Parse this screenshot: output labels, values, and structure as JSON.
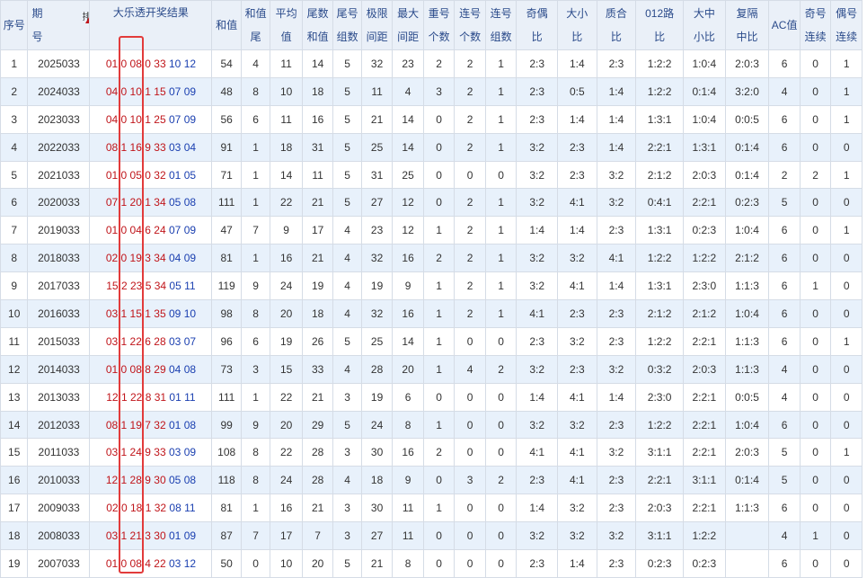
{
  "headers": {
    "idx": "序号",
    "period1": "期",
    "period2": "号",
    "sort": "排序",
    "result": "大乐透开奖结果",
    "sum": "和值",
    "sumtail1": "和值",
    "sumtail2": "尾",
    "avg1": "平均",
    "avg2": "值",
    "tailsum1": "尾数",
    "tailsum2": "和值",
    "tailgroup1": "尾号",
    "tailgroup2": "组数",
    "span1": "极限",
    "span2": "间距",
    "maxgap1": "最大",
    "maxgap2": "间距",
    "repeat1": "重号",
    "repeat2": "个数",
    "consec1": "连号",
    "consec2": "个数",
    "consecg1": "连号",
    "consecg2": "组数",
    "oddeven1": "奇偶",
    "oddeven2": "比",
    "bigsmall1": "大小",
    "bigsmall2": "比",
    "prime1": "质合",
    "prime2": "比",
    "road1": "012路",
    "road2": "比",
    "bms1": "大中",
    "bms2": "小比",
    "rep1": "复隔",
    "rep2": "中比",
    "ac": "AC值",
    "oddc1": "奇号",
    "oddc2": "连续",
    "evenc1": "偶号",
    "evenc2": "连续"
  },
  "rows": [
    {
      "i": "1",
      "p": "2025033",
      "r": [
        "01",
        "0",
        "08",
        "0",
        "33"
      ],
      "b": [
        "10",
        "12"
      ],
      "s": "54",
      "st": "4",
      "a": "11",
      "ts": "14",
      "tg": "5",
      "sp": "32",
      "mg": "23",
      "rp": "2",
      "cn": "2",
      "cg": "1",
      "oe": "2:3",
      "bs": "1:4",
      "pc": "2:3",
      "rd": "1:2:2",
      "bm": "1:0:4",
      "rh": "2:0:3",
      "ac": "6",
      "oc": "0",
      "ec": "1"
    },
    {
      "i": "2",
      "p": "2024033",
      "r": [
        "04",
        "0",
        "10",
        "1",
        "15"
      ],
      "b": [
        "07",
        "09"
      ],
      "s": "48",
      "st": "8",
      "a": "10",
      "ts": "18",
      "tg": "5",
      "sp": "11",
      "mg": "4",
      "rp": "3",
      "cn": "2",
      "cg": "1",
      "oe": "2:3",
      "bs": "0:5",
      "pc": "1:4",
      "rd": "1:2:2",
      "bm": "0:1:4",
      "rh": "3:2:0",
      "ac": "4",
      "oc": "0",
      "ec": "1"
    },
    {
      "i": "3",
      "p": "2023033",
      "r": [
        "04",
        "0",
        "10",
        "1",
        "25"
      ],
      "b": [
        "07",
        "09"
      ],
      "s": "56",
      "st": "6",
      "a": "11",
      "ts": "16",
      "tg": "5",
      "sp": "21",
      "mg": "14",
      "rp": "0",
      "cn": "2",
      "cg": "1",
      "oe": "2:3",
      "bs": "1:4",
      "pc": "1:4",
      "rd": "1:3:1",
      "bm": "1:0:4",
      "rh": "0:0:5",
      "ac": "6",
      "oc": "0",
      "ec": "1"
    },
    {
      "i": "4",
      "p": "2022033",
      "r": [
        "08",
        "1",
        "16",
        "9",
        "33"
      ],
      "b": [
        "03",
        "04"
      ],
      "s": "91",
      "st": "1",
      "a": "18",
      "ts": "31",
      "tg": "5",
      "sp": "25",
      "mg": "14",
      "rp": "0",
      "cn": "2",
      "cg": "1",
      "oe": "3:2",
      "bs": "2:3",
      "pc": "1:4",
      "rd": "2:2:1",
      "bm": "1:3:1",
      "rh": "0:1:4",
      "ac": "6",
      "oc": "0",
      "ec": "0"
    },
    {
      "i": "5",
      "p": "2021033",
      "r": [
        "01",
        "0",
        "05",
        "0",
        "32"
      ],
      "b": [
        "01",
        "05"
      ],
      "s": "71",
      "st": "1",
      "a": "14",
      "ts": "11",
      "tg": "5",
      "sp": "31",
      "mg": "25",
      "rp": "0",
      "cn": "0",
      "cg": "0",
      "oe": "3:2",
      "bs": "2:3",
      "pc": "3:2",
      "rd": "2:1:2",
      "bm": "2:0:3",
      "rh": "0:1:4",
      "ac": "2",
      "oc": "2",
      "ec": "1"
    },
    {
      "i": "6",
      "p": "2020033",
      "r": [
        "07",
        "1",
        "20",
        "1",
        "34"
      ],
      "b": [
        "05",
        "08"
      ],
      "s": "111",
      "st": "1",
      "a": "22",
      "ts": "21",
      "tg": "5",
      "sp": "27",
      "mg": "12",
      "rp": "0",
      "cn": "2",
      "cg": "1",
      "oe": "3:2",
      "bs": "4:1",
      "pc": "3:2",
      "rd": "0:4:1",
      "bm": "2:2:1",
      "rh": "0:2:3",
      "ac": "5",
      "oc": "0",
      "ec": "0"
    },
    {
      "i": "7",
      "p": "2019033",
      "r": [
        "01",
        "0",
        "04",
        "6",
        "24"
      ],
      "b": [
        "07",
        "09"
      ],
      "s": "47",
      "st": "7",
      "a": "9",
      "ts": "17",
      "tg": "4",
      "sp": "23",
      "mg": "12",
      "rp": "1",
      "cn": "2",
      "cg": "1",
      "oe": "1:4",
      "bs": "1:4",
      "pc": "2:3",
      "rd": "1:3:1",
      "bm": "0:2:3",
      "rh": "1:0:4",
      "ac": "6",
      "oc": "0",
      "ec": "1"
    },
    {
      "i": "8",
      "p": "2018033",
      "r": [
        "02",
        "0",
        "19",
        "3",
        "34"
      ],
      "b": [
        "04",
        "09"
      ],
      "s": "81",
      "st": "1",
      "a": "16",
      "ts": "21",
      "tg": "4",
      "sp": "32",
      "mg": "16",
      "rp": "2",
      "cn": "2",
      "cg": "1",
      "oe": "3:2",
      "bs": "3:2",
      "pc": "4:1",
      "rd": "1:2:2",
      "bm": "1:2:2",
      "rh": "2:1:2",
      "ac": "6",
      "oc": "0",
      "ec": "0"
    },
    {
      "i": "9",
      "p": "2017033",
      "r": [
        "15",
        "2",
        "23",
        "5",
        "34"
      ],
      "b": [
        "05",
        "11"
      ],
      "s": "119",
      "st": "9",
      "a": "24",
      "ts": "19",
      "tg": "4",
      "sp": "19",
      "mg": "9",
      "rp": "1",
      "cn": "2",
      "cg": "1",
      "oe": "3:2",
      "bs": "4:1",
      "pc": "1:4",
      "rd": "1:3:1",
      "bm": "2:3:0",
      "rh": "1:1:3",
      "ac": "6",
      "oc": "1",
      "ec": "0"
    },
    {
      "i": "10",
      "p": "2016033",
      "r": [
        "03",
        "1",
        "15",
        "1",
        "35"
      ],
      "b": [
        "09",
        "10"
      ],
      "s": "98",
      "st": "8",
      "a": "20",
      "ts": "18",
      "tg": "4",
      "sp": "32",
      "mg": "16",
      "rp": "1",
      "cn": "2",
      "cg": "1",
      "oe": "4:1",
      "bs": "2:3",
      "pc": "2:3",
      "rd": "2:1:2",
      "bm": "2:1:2",
      "rh": "1:0:4",
      "ac": "6",
      "oc": "0",
      "ec": "0"
    },
    {
      "i": "11",
      "p": "2015033",
      "r": [
        "03",
        "1",
        "22",
        "6",
        "28"
      ],
      "b": [
        "03",
        "07"
      ],
      "s": "96",
      "st": "6",
      "a": "19",
      "ts": "26",
      "tg": "5",
      "sp": "25",
      "mg": "14",
      "rp": "1",
      "cn": "0",
      "cg": "0",
      "oe": "2:3",
      "bs": "3:2",
      "pc": "2:3",
      "rd": "1:2:2",
      "bm": "2:2:1",
      "rh": "1:1:3",
      "ac": "6",
      "oc": "0",
      "ec": "1"
    },
    {
      "i": "12",
      "p": "2014033",
      "r": [
        "01",
        "0",
        "08",
        "8",
        "29"
      ],
      "b": [
        "04",
        "08"
      ],
      "s": "73",
      "st": "3",
      "a": "15",
      "ts": "33",
      "tg": "4",
      "sp": "28",
      "mg": "20",
      "rp": "1",
      "cn": "4",
      "cg": "2",
      "oe": "3:2",
      "bs": "2:3",
      "pc": "3:2",
      "rd": "0:3:2",
      "bm": "2:0:3",
      "rh": "1:1:3",
      "ac": "4",
      "oc": "0",
      "ec": "0"
    },
    {
      "i": "13",
      "p": "2013033",
      "r": [
        "12",
        "1",
        "22",
        "8",
        "31"
      ],
      "b": [
        "01",
        "11"
      ],
      "s": "111",
      "st": "1",
      "a": "22",
      "ts": "21",
      "tg": "3",
      "sp": "19",
      "mg": "6",
      "rp": "0",
      "cn": "0",
      "cg": "0",
      "oe": "1:4",
      "bs": "4:1",
      "pc": "1:4",
      "rd": "2:3:0",
      "bm": "2:2:1",
      "rh": "0:0:5",
      "ac": "4",
      "oc": "0",
      "ec": "0"
    },
    {
      "i": "14",
      "p": "2012033",
      "r": [
        "08",
        "1",
        "19",
        "7",
        "32"
      ],
      "b": [
        "01",
        "08"
      ],
      "s": "99",
      "st": "9",
      "a": "20",
      "ts": "29",
      "tg": "5",
      "sp": "24",
      "mg": "8",
      "rp": "1",
      "cn": "0",
      "cg": "0",
      "oe": "3:2",
      "bs": "3:2",
      "pc": "2:3",
      "rd": "1:2:2",
      "bm": "2:2:1",
      "rh": "1:0:4",
      "ac": "6",
      "oc": "0",
      "ec": "0"
    },
    {
      "i": "15",
      "p": "2011033",
      "r": [
        "03",
        "1",
        "24",
        "9",
        "33"
      ],
      "b": [
        "03",
        "09"
      ],
      "s": "108",
      "st": "8",
      "a": "22",
      "ts": "28",
      "tg": "3",
      "sp": "30",
      "mg": "16",
      "rp": "2",
      "cn": "0",
      "cg": "0",
      "oe": "4:1",
      "bs": "4:1",
      "pc": "3:2",
      "rd": "3:1:1",
      "bm": "2:2:1",
      "rh": "2:0:3",
      "ac": "5",
      "oc": "0",
      "ec": "1"
    },
    {
      "i": "16",
      "p": "2010033",
      "r": [
        "12",
        "1",
        "28",
        "9",
        "30"
      ],
      "b": [
        "05",
        "08"
      ],
      "s": "118",
      "st": "8",
      "a": "24",
      "ts": "28",
      "tg": "4",
      "sp": "18",
      "mg": "9",
      "rp": "0",
      "cn": "3",
      "cg": "2",
      "oe": "2:3",
      "bs": "4:1",
      "pc": "2:3",
      "rd": "2:2:1",
      "bm": "3:1:1",
      "rh": "0:1:4",
      "ac": "5",
      "oc": "0",
      "ec": "0"
    },
    {
      "i": "17",
      "p": "2009033",
      "r": [
        "02",
        "0",
        "18",
        "1",
        "32"
      ],
      "b": [
        "08",
        "11"
      ],
      "s": "81",
      "st": "1",
      "a": "16",
      "ts": "21",
      "tg": "3",
      "sp": "30",
      "mg": "11",
      "rp": "1",
      "cn": "0",
      "cg": "0",
      "oe": "1:4",
      "bs": "3:2",
      "pc": "2:3",
      "rd": "2:0:3",
      "bm": "2:2:1",
      "rh": "1:1:3",
      "ac": "6",
      "oc": "0",
      "ec": "0"
    },
    {
      "i": "18",
      "p": "2008033",
      "r": [
        "03",
        "1",
        "21",
        "3",
        "30"
      ],
      "b": [
        "01",
        "09"
      ],
      "s": "87",
      "st": "7",
      "a": "17",
      "ts": "7",
      "tg": "3",
      "sp": "27",
      "mg": "11",
      "rp": "0",
      "cn": "0",
      "cg": "0",
      "oe": "3:2",
      "bs": "3:2",
      "pc": "3:2",
      "rd": "3:1:1",
      "bm": "1:2:2",
      "rh": "",
      "ac": "4",
      "oc": "1",
      "ec": "0"
    },
    {
      "i": "19",
      "p": "2007033",
      "r": [
        "01",
        "0",
        "08",
        "4",
        "22"
      ],
      "b": [
        "03",
        "12"
      ],
      "s": "50",
      "st": "0",
      "a": "10",
      "ts": "20",
      "tg": "5",
      "sp": "21",
      "mg": "8",
      "rp": "0",
      "cn": "0",
      "cg": "0",
      "oe": "2:3",
      "bs": "1:4",
      "pc": "2:3",
      "rd": "0:2:3",
      "bm": "0:2:3",
      "rh": "",
      "ac": "6",
      "oc": "0",
      "ec": "0"
    }
  ],
  "colors": {
    "red": "#c0151a",
    "blue": "#1a3fb0",
    "highlight": "#e23b3b",
    "header_bg": "#eaf0f8",
    "stripe": "#e8f1fb"
  }
}
